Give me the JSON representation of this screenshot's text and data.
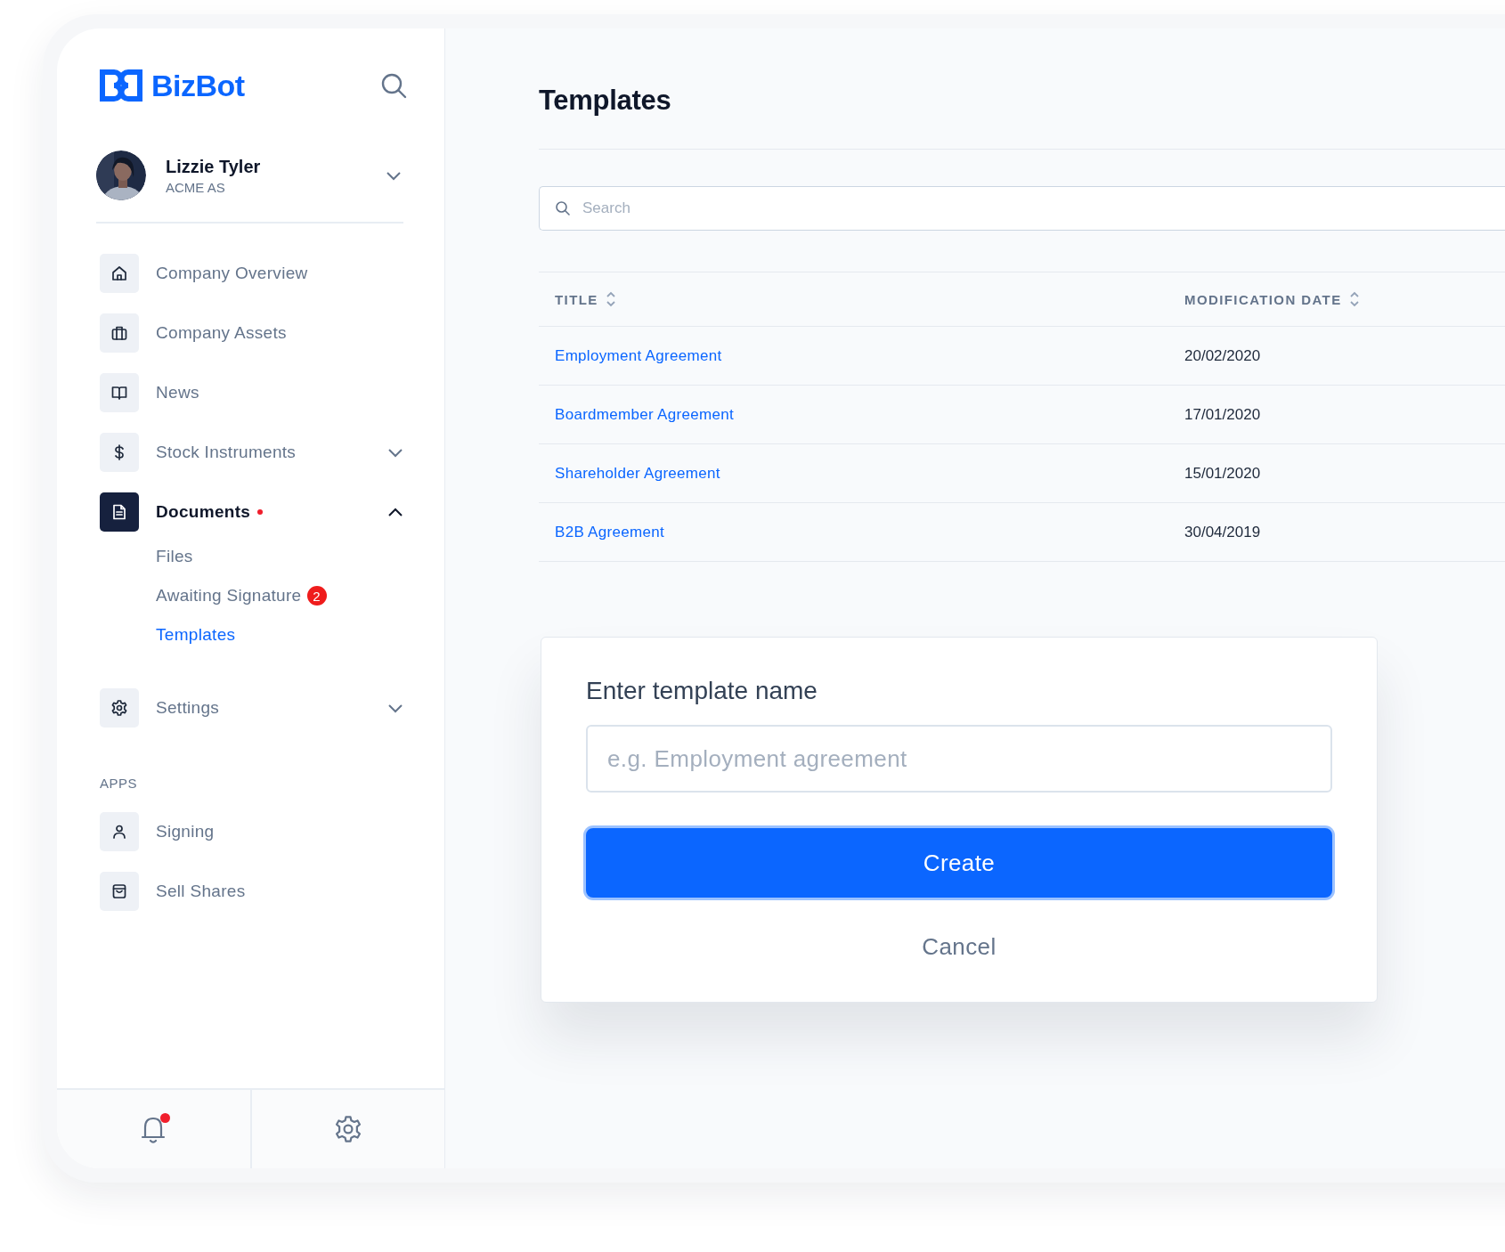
{
  "brand": {
    "name": "BizBot"
  },
  "user": {
    "name": "Lizzie Tyler",
    "company": "ACME AS"
  },
  "nav": [
    {
      "label": "Company Overview",
      "kind": "link",
      "selected": false
    },
    {
      "label": "Company Assets",
      "kind": "link",
      "selected": false
    },
    {
      "label": "News",
      "kind": "link",
      "selected": false
    },
    {
      "label": "Stock Instruments",
      "kind": "group",
      "selected": false,
      "expanded": false
    },
    {
      "label": "Documents",
      "kind": "group",
      "selected": true,
      "expanded": true,
      "alert": true,
      "children": [
        {
          "label": "Files",
          "selected": false
        },
        {
          "label": "Awaiting Signature",
          "selected": false,
          "badge": "2"
        },
        {
          "label": "Templates",
          "selected": true
        }
      ]
    },
    {
      "label": "Settings",
      "kind": "group",
      "selected": false,
      "expanded": false
    }
  ],
  "apps": {
    "heading": "APPS",
    "items": [
      {
        "label": "Signing",
        "selected": false
      },
      {
        "label": "Sell Shares",
        "selected": false
      }
    ]
  },
  "footer": {
    "notifications_unread": true
  },
  "page": {
    "title": "Templates",
    "search": {
      "placeholder": "Search"
    },
    "table": {
      "columns": [
        "TITLE",
        "MODIFICATION DATE"
      ],
      "rows": [
        {
          "title": "Employment Agreement",
          "date": "20/02/2020"
        },
        {
          "title": "Boardmember Agreement",
          "date": "17/01/2020"
        },
        {
          "title": "Shareholder Agreement",
          "date": "15/01/2020"
        },
        {
          "title": "B2B Agreement",
          "date": "30/04/2019"
        }
      ]
    }
  },
  "dialog": {
    "title": "Enter template name",
    "placeholder": "e.g. Employment agreement",
    "primary": "Create",
    "secondary": "Cancel"
  }
}
